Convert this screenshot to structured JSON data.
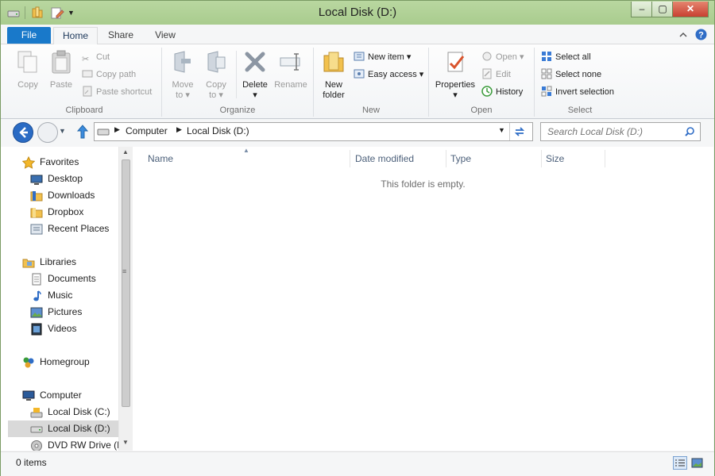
{
  "window": {
    "title": "Local Disk (D:)",
    "minimize_glyph": "–",
    "maximize_glyph": "▢",
    "close_glyph": "✕"
  },
  "tabs": [
    {
      "label": "File"
    },
    {
      "label": "Home"
    },
    {
      "label": "Share"
    },
    {
      "label": "View"
    }
  ],
  "ribbon": {
    "clipboard": {
      "label": "Clipboard",
      "copy": "Copy",
      "paste": "Paste",
      "cut": "Cut",
      "copy_path": "Copy path",
      "paste_shortcut": "Paste shortcut"
    },
    "organize": {
      "label": "Organize",
      "move_to_1": "Move",
      "move_to_2": "to ▾",
      "copy_to_1": "Copy",
      "copy_to_2": "to ▾",
      "delete_1": "Delete",
      "delete_2": "▾",
      "rename": "Rename"
    },
    "new": {
      "label": "New",
      "new_folder_1": "New",
      "new_folder_2": "folder",
      "new_item": "New item ▾",
      "easy_access": "Easy access ▾"
    },
    "open": {
      "label": "Open",
      "properties_1": "Properties",
      "properties_2": "▾",
      "open": "Open ▾",
      "edit": "Edit",
      "history": "History"
    },
    "select": {
      "label": "Select",
      "select_all": "Select all",
      "select_none": "Select none",
      "invert_selection": "Invert selection"
    }
  },
  "address": {
    "crumbs": [
      "Computer",
      "Local Disk (D:)"
    ],
    "search_placeholder": "Search Local Disk (D:)"
  },
  "navpane": {
    "items": [
      {
        "label": "Favorites",
        "icon": "star-icon"
      },
      {
        "label": "Desktop",
        "icon": "desktop-icon"
      },
      {
        "label": "Downloads",
        "icon": "folder-icon"
      },
      {
        "label": "Dropbox",
        "icon": "folder-icon"
      },
      {
        "label": "Recent Places",
        "icon": "recent-places-icon"
      },
      {
        "label": "Libraries",
        "icon": "libraries-icon"
      },
      {
        "label": "Documents",
        "icon": "documents-icon"
      },
      {
        "label": "Music",
        "icon": "music-icon"
      },
      {
        "label": "Pictures",
        "icon": "pictures-icon"
      },
      {
        "label": "Videos",
        "icon": "videos-icon"
      },
      {
        "label": "Homegroup",
        "icon": "homegroup-icon"
      },
      {
        "label": "Computer",
        "icon": "computer-icon"
      },
      {
        "label": "Local Disk (C:)",
        "icon": "drive-icon"
      },
      {
        "label": "Local Disk (D:)",
        "icon": "drive-icon"
      },
      {
        "label": "DVD RW Drive (E:",
        "icon": "dvd-icon"
      }
    ]
  },
  "content": {
    "columns": [
      {
        "label": "Name"
      },
      {
        "label": "Date modified"
      },
      {
        "label": "Type"
      },
      {
        "label": "Size"
      }
    ],
    "empty_text": "This folder is empty."
  },
  "status": {
    "items_count": "0 items"
  },
  "colors": {
    "file_tab": "#1979ca",
    "titlebar": "#b1d196",
    "selected": "#cde8ff",
    "close_button": "#c84031"
  }
}
